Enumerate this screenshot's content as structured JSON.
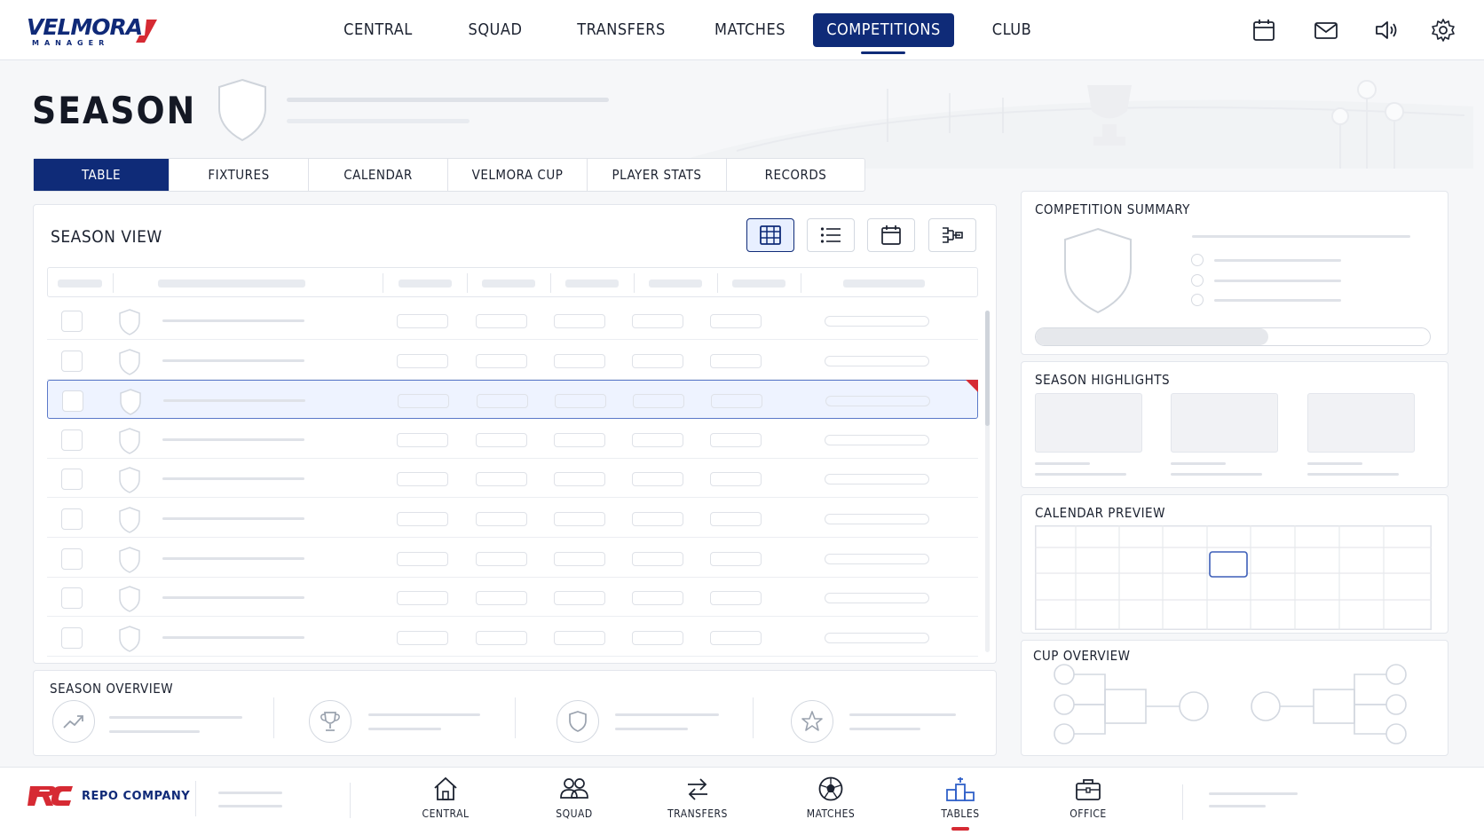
{
  "app": {
    "logo_text": "VELMORA",
    "logo_subtext": "MANAGER"
  },
  "top_nav": {
    "items": [
      {
        "label": "CENTRAL"
      },
      {
        "label": "SQUAD"
      },
      {
        "label": "TRANSFERS"
      },
      {
        "label": "MATCHES"
      },
      {
        "label": "COMPETITIONS",
        "active": true
      },
      {
        "label": "CLUB"
      }
    ],
    "icons": [
      "calendar-icon",
      "mail-icon",
      "speaker-icon",
      "gear-icon"
    ]
  },
  "page": {
    "title": "SEASON"
  },
  "tabs": [
    {
      "label": "TABLE",
      "active": true
    },
    {
      "label": "FIXTURES"
    },
    {
      "label": "CALENDAR"
    },
    {
      "label": "VELMORA CUP"
    },
    {
      "label": "PLAYER STATS"
    },
    {
      "label": "RECORDS"
    }
  ],
  "season_view": {
    "title": "SEASON VIEW",
    "view_modes": [
      "table-view-icon",
      "list-view-icon",
      "calendar-view-icon",
      "bracket-view-icon"
    ],
    "selected_row": 3
  },
  "season_overview": {
    "title": "SEASON OVERVIEW",
    "icons": [
      "trend-icon",
      "trophy-icon",
      "shield-icon",
      "star-icon"
    ]
  },
  "competition_summary": {
    "title": "COMPETITION SUMMARY",
    "progress": 0.59
  },
  "season_highlights": {
    "title": "SEASON HIGHLIGHTS"
  },
  "calendar_preview": {
    "title": "CALENDAR PREVIEW"
  },
  "cup_overview": {
    "title": "CUP OVERVIEW"
  },
  "footer": {
    "sponsor_name": "REPO COMPANY",
    "nav": [
      {
        "label": "CENTRAL",
        "icon": "home-icon"
      },
      {
        "label": "SQUAD",
        "icon": "users-icon"
      },
      {
        "label": "TRANSFERS",
        "icon": "transfer-icon"
      },
      {
        "label": "MATCHES",
        "icon": "ball-icon"
      },
      {
        "label": "TABLES",
        "icon": "podium-icon",
        "active": true
      },
      {
        "label": "OFFICE",
        "icon": "briefcase-icon"
      }
    ]
  },
  "colors": {
    "brand_navy": "#0f2b78",
    "accent_red": "#d62a33",
    "selection_bg": "#eef3ff"
  }
}
